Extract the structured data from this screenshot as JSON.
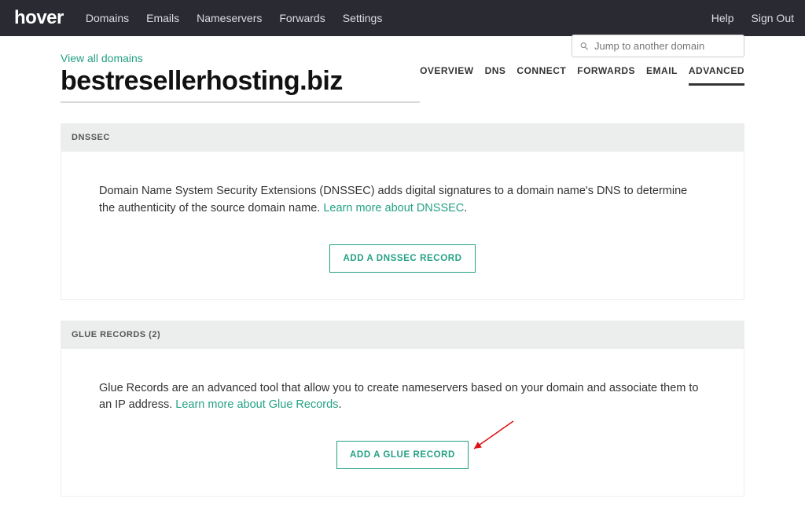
{
  "brand": "hover",
  "nav": {
    "domains": "Domains",
    "emails": "Emails",
    "nameservers": "Nameservers",
    "forwards": "Forwards",
    "settings": "Settings",
    "help": "Help",
    "signout": "Sign Out"
  },
  "backlink": "View all domains",
  "domain_name": "bestresellerhosting.biz",
  "search": {
    "placeholder": "Jump to another domain"
  },
  "tabs": {
    "overview": "OVERVIEW",
    "dns": "DNS",
    "connect": "CONNECT",
    "forwards": "FORWARDS",
    "email": "EMAIL",
    "advanced": "ADVANCED"
  },
  "dnssec": {
    "header": "DNSSEC",
    "desc": "Domain Name System Security Extensions (DNSSEC) adds digital signatures to a domain name's DNS to determine the authenticity of the source domain name. ",
    "learn_link": "Learn more about DNSSEC",
    "button": "ADD A DNSSEC RECORD"
  },
  "glue": {
    "header": "GLUE RECORDS (2)",
    "desc": "Glue Records are an advanced tool that allow you to create nameservers based on your domain and associate them to an IP address. ",
    "learn_link": "Learn more about Glue Records",
    "button": "ADD A GLUE RECORD"
  }
}
